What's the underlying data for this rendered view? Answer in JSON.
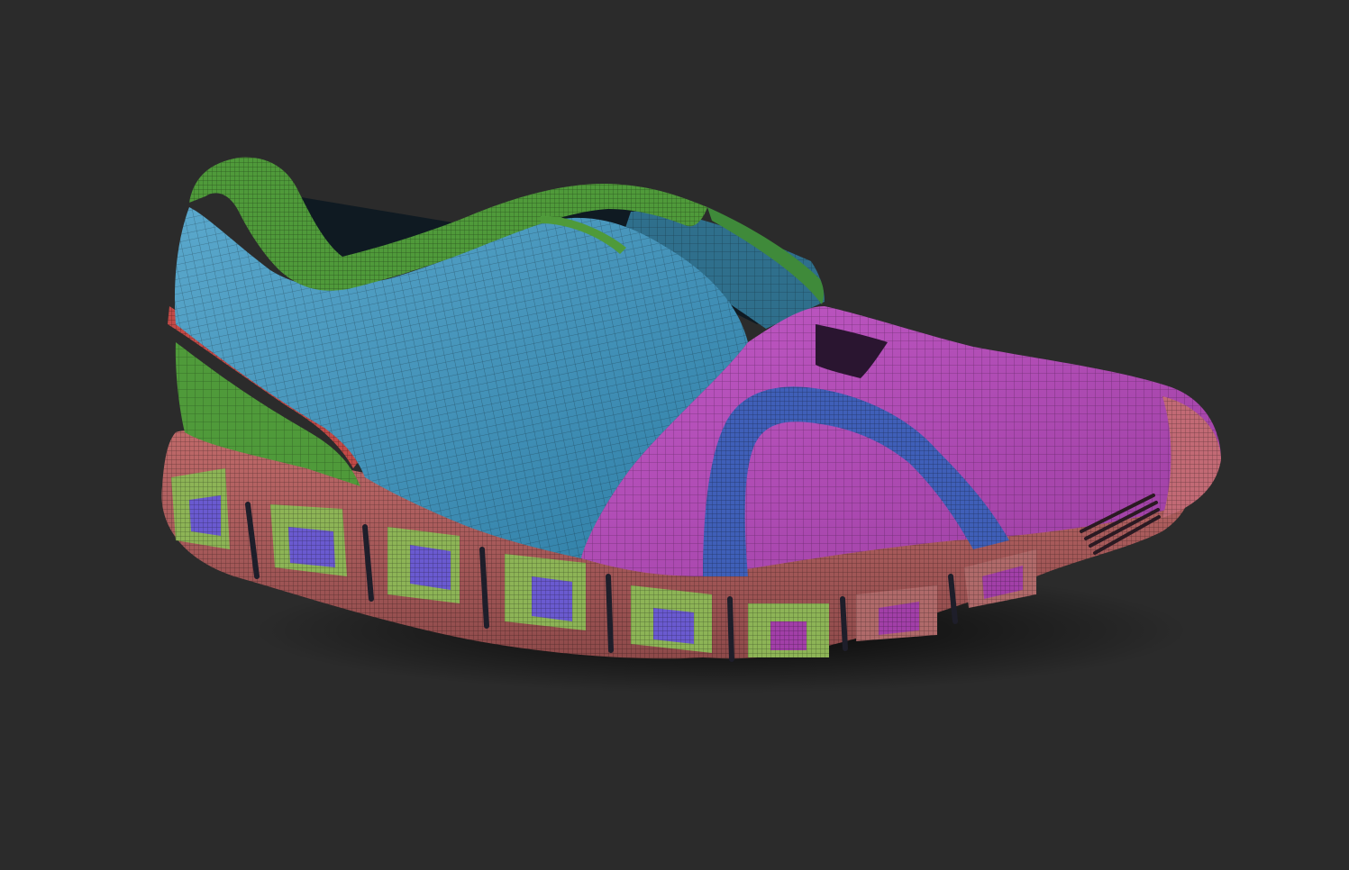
{
  "viewport": {
    "background": "#2b2b2b"
  },
  "model": {
    "subject": "shoe",
    "render_style": "polygroup-wireframe",
    "polygroups": [
      {
        "name": "collar",
        "color": "#4f9a3a"
      },
      {
        "name": "quarter",
        "color": "#3f8fb4"
      },
      {
        "name": "vamp",
        "color": "#b24bb4"
      },
      {
        "name": "eyestay",
        "color": "#3f5fb8"
      },
      {
        "name": "heel-counter",
        "color": "#4f9a3a"
      },
      {
        "name": "heel-stripe",
        "color": "#c24a47"
      },
      {
        "name": "midsole",
        "color": "#b46060"
      },
      {
        "name": "cloud-pods",
        "color": "#8db456"
      },
      {
        "name": "outsole-rubber",
        "color": "#6a5ad0"
      }
    ]
  }
}
